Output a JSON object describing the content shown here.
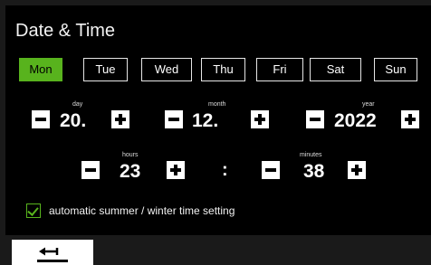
{
  "header": {
    "title": "Date & Time"
  },
  "weekdays": {
    "selected": "Mon",
    "items": [
      "Mon",
      "Tue",
      "Wed",
      "Thu",
      "Fri",
      "Sat",
      "Sun"
    ]
  },
  "date": {
    "day": {
      "label": "day",
      "value": "20."
    },
    "month": {
      "label": "month",
      "value": "12."
    },
    "year": {
      "label": "year",
      "value": "2022"
    }
  },
  "time": {
    "hours": {
      "label": "hours",
      "value": "23"
    },
    "separator": ":",
    "minutes": {
      "label": "minutes",
      "value": "38"
    }
  },
  "dst": {
    "label": "automatic summer / winter time setting",
    "checked": true
  },
  "footer": {
    "back_icon": "return-arrow-icon"
  },
  "colors": {
    "accent": "#58b31d",
    "background": "#000000",
    "button": "#ffffff"
  }
}
